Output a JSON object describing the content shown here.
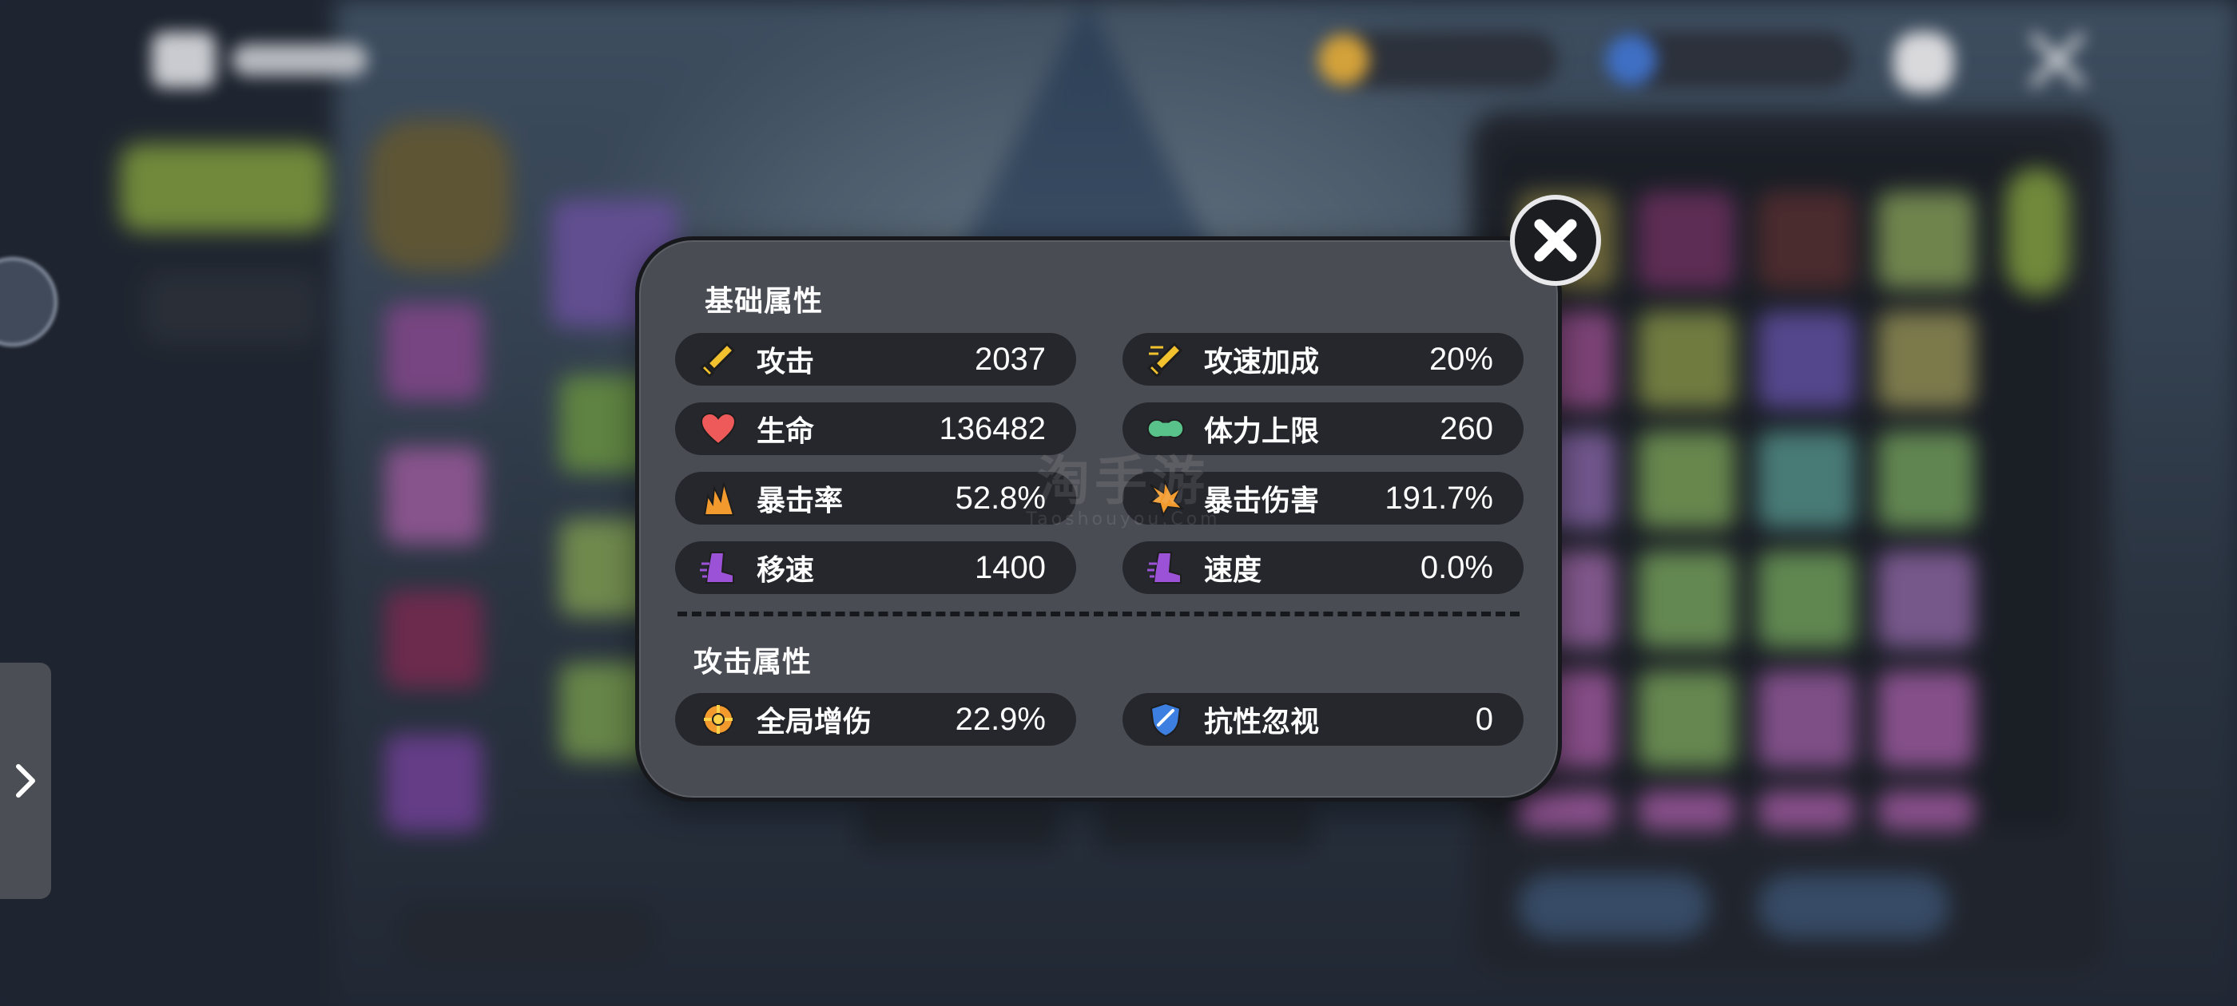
{
  "panel": {
    "basic_title": "基础属性",
    "attack_title": "攻击属性",
    "basic_stats": [
      {
        "label": "攻击",
        "value": "2037",
        "icon": "sword-icon"
      },
      {
        "label": "攻速加成",
        "value": "20%",
        "icon": "swift-sword-icon"
      },
      {
        "label": "生命",
        "value": "136482",
        "icon": "heart-icon"
      },
      {
        "label": "体力上限",
        "value": "260",
        "icon": "muscle-icon"
      },
      {
        "label": "暴击率",
        "value": "52.8%",
        "icon": "critical-rate-icon"
      },
      {
        "label": "暴击伤害",
        "value": "191.7%",
        "icon": "critical-damage-icon"
      },
      {
        "label": "移速",
        "value": "1400",
        "icon": "boot-icon"
      },
      {
        "label": "速度",
        "value": "0.0%",
        "icon": "boot-icon"
      }
    ],
    "attack_stats": [
      {
        "label": "全局增伤",
        "value": "22.9%",
        "icon": "damage-boost-icon"
      },
      {
        "label": "抗性忽视",
        "value": "0",
        "icon": "shield-pierce-icon"
      }
    ]
  },
  "watermark": {
    "main": "淘手游",
    "sub": "Taoshouyou.Com"
  },
  "colors": {
    "panel_bg": "#4a4c53",
    "row_bg": "#25272d",
    "panel_border": "#17181c",
    "text": "#ffffff"
  }
}
